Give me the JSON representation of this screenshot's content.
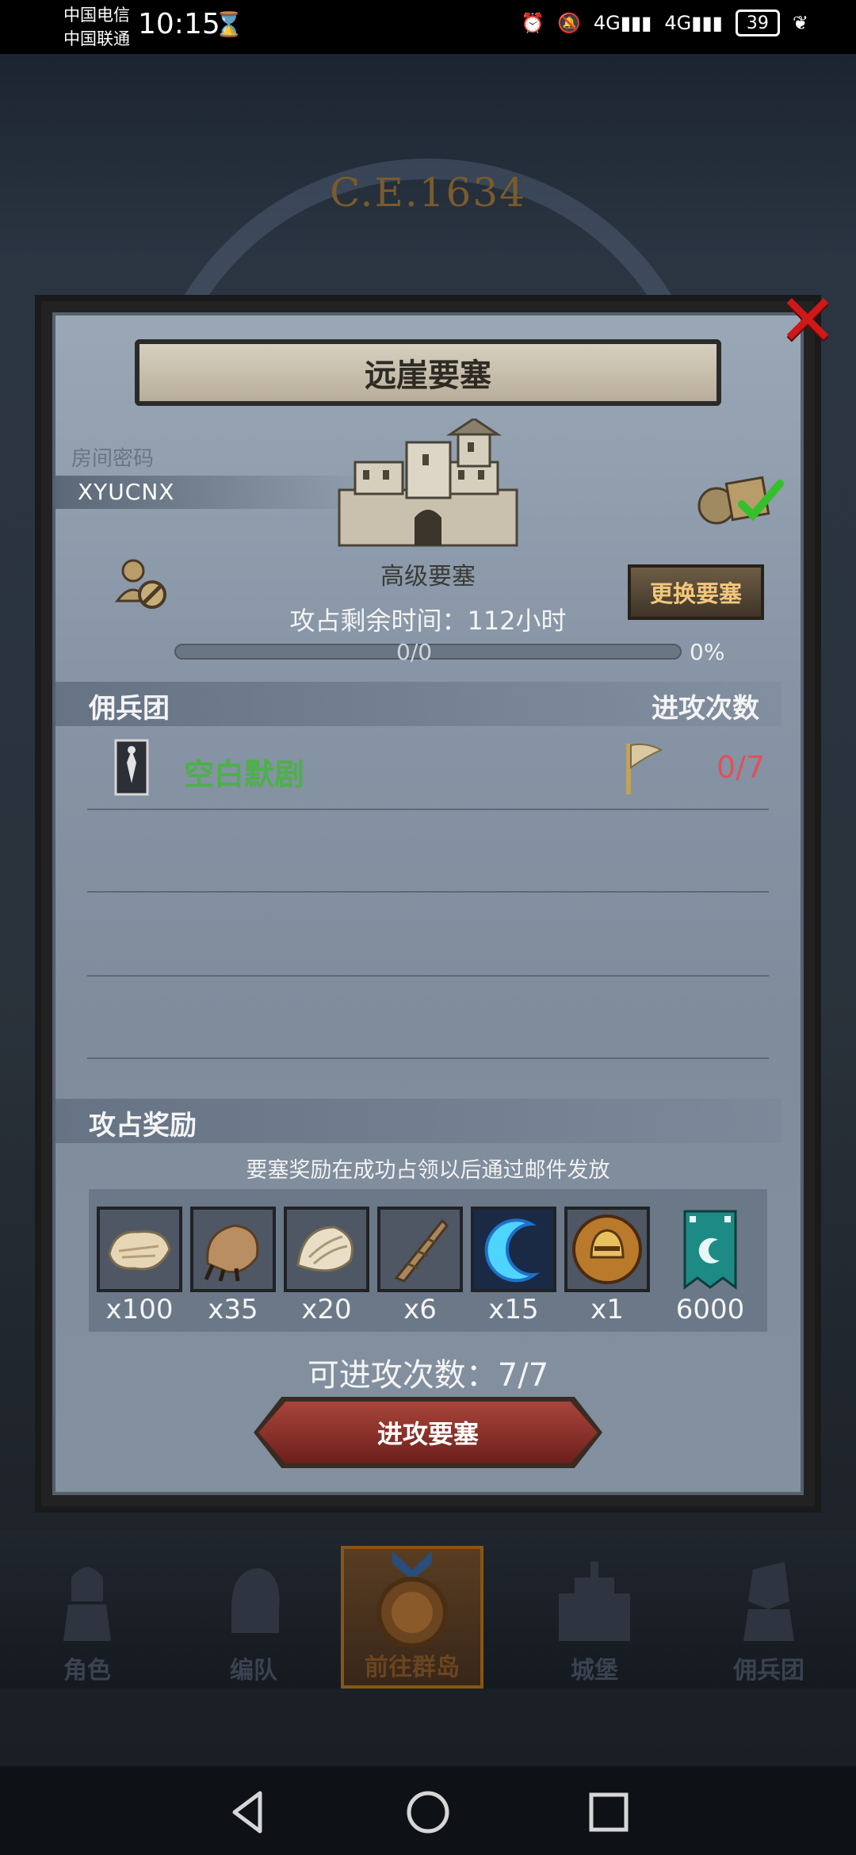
{
  "status": {
    "carrier1": "中国电信",
    "carrier2": "中国联通",
    "time": "10:15",
    "battery": "39",
    "signal1": "4G",
    "signal2": "4G"
  },
  "background": {
    "era": "C.E.1634"
  },
  "modal": {
    "title": "远崖要塞",
    "room_label": "房间密码",
    "room_code": "XYUCNX",
    "fortress_grade": "高级要塞",
    "change_button": "更换要塞",
    "remaining_time": "攻占剩余时间：112小时",
    "progress": {
      "text": "0/0",
      "percent": "0%",
      "fraction": 0
    },
    "mercenary_header": "佣兵团",
    "attack_count_header": "进攻次数",
    "mercenary": {
      "name": "空白默剧",
      "attacks": "0/7"
    },
    "rewards_header": "攻占奖励",
    "reward_note": "要塞奖励在成功占领以后通过邮件发放",
    "rewards": [
      {
        "icon": "fur-pelt-icon",
        "qty": "x100"
      },
      {
        "icon": "beast-claw-icon",
        "qty": "x35"
      },
      {
        "icon": "scale-hide-icon",
        "qty": "x20"
      },
      {
        "icon": "horn-icon",
        "qty": "x6"
      },
      {
        "icon": "blue-crescent-icon",
        "qty": "x15"
      },
      {
        "icon": "helmet-medal-icon",
        "qty": "x1"
      },
      {
        "icon": "guild-banner-icon",
        "qty": "6000"
      }
    ],
    "attacks_left": "可进攻次数：7/7",
    "attack_button": "进攻要塞"
  },
  "bottom_nav": [
    {
      "label": "角色",
      "active": false
    },
    {
      "label": "编队",
      "active": false
    },
    {
      "label": "前往群岛",
      "active": true
    },
    {
      "label": "城堡",
      "active": false
    },
    {
      "label": "佣兵团",
      "active": false
    }
  ],
  "colors": {
    "accent_green": "#4db04a",
    "count_red": "#e0505a",
    "close_red": "#d01818",
    "button_gold_text": "#f2c77c"
  }
}
